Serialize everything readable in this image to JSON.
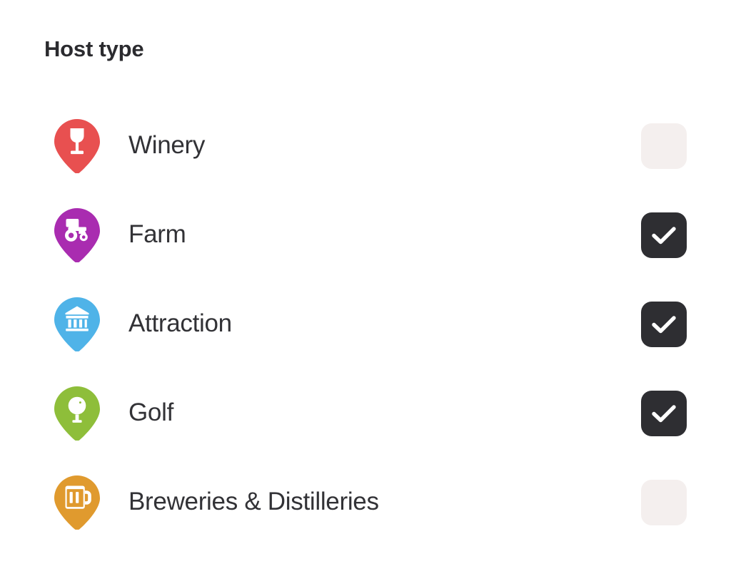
{
  "panel": {
    "title": "Host type"
  },
  "colors": {
    "winery_pin": "#e85050",
    "farm_pin": "#a92cb0",
    "attraction_pin": "#4fb3e8",
    "golf_pin": "#8ebe3a",
    "brewery_pin": "#e09a2e",
    "checkbox_checked": "#2e2e32",
    "checkbox_unchecked": "#f4efee",
    "title_text": "#2b2b2f",
    "label_text": "#323236",
    "background": "#ffffff"
  },
  "items": [
    {
      "label": "Winery",
      "icon": "wine-glass-pin-icon",
      "pin_color": "#e85050",
      "checked": false,
      "checkbox_name": "checkbox-winery"
    },
    {
      "label": "Farm",
      "icon": "tractor-pin-icon",
      "pin_color": "#a92cb0",
      "checked": true,
      "checkbox_name": "checkbox-farm"
    },
    {
      "label": "Attraction",
      "icon": "museum-pin-icon",
      "pin_color": "#4fb3e8",
      "checked": true,
      "checkbox_name": "checkbox-attraction"
    },
    {
      "label": "Golf",
      "icon": "golf-ball-tee-pin-icon",
      "pin_color": "#8ebe3a",
      "checked": true,
      "checkbox_name": "checkbox-golf"
    },
    {
      "label": "Breweries & Distilleries",
      "icon": "beer-mug-pin-icon",
      "pin_color": "#e09a2e",
      "checked": false,
      "checkbox_name": "checkbox-breweries-distilleries"
    }
  ]
}
